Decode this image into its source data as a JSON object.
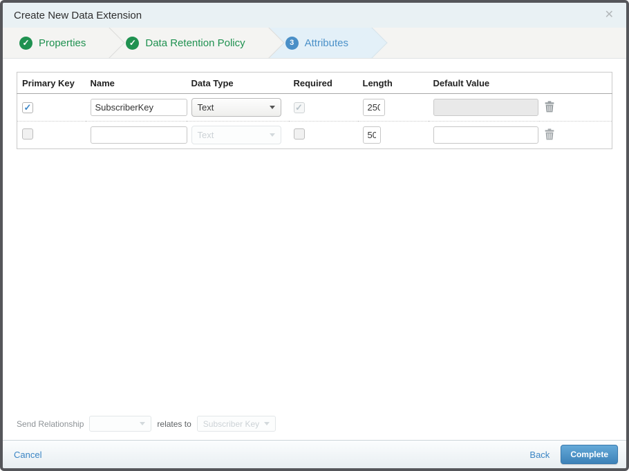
{
  "dialog": {
    "title": "Create New Data Extension",
    "close_icon": "✕"
  },
  "steps": [
    {
      "label": "Properties",
      "status": "complete",
      "icon": "✓"
    },
    {
      "label": "Data Retention Policy",
      "status": "complete",
      "icon": "✓"
    },
    {
      "label": "Attributes",
      "status": "current",
      "number": "3"
    }
  ],
  "table": {
    "headers": [
      "Primary Key",
      "Name",
      "Data Type",
      "Required",
      "Length",
      "Default Value"
    ],
    "rows": [
      {
        "primary_key_checked": true,
        "name": "SubscriberKey",
        "data_type": "Text",
        "required_checked": true,
        "required_disabled": true,
        "length": "250",
        "default_value": "",
        "default_disabled": true
      },
      {
        "primary_key_checked": false,
        "name": "",
        "data_type": "Text",
        "data_type_disabled": true,
        "required_checked": false,
        "length": "50",
        "default_value": "",
        "default_disabled": false
      }
    ]
  },
  "send_relationship": {
    "label": "Send Relationship",
    "field_value": "",
    "relates_to_label": "relates to",
    "target_value": "Subscriber Key"
  },
  "footer": {
    "cancel_label": "Cancel",
    "back_label": "Back",
    "complete_label": "Complete"
  },
  "colors": {
    "accent_green": "#1f9150",
    "accent_blue": "#4a90c8",
    "button_blue": "#3d82b8",
    "titlebar_bg": "#e9f1f4",
    "active_step_bg": "#e3f0f8"
  }
}
